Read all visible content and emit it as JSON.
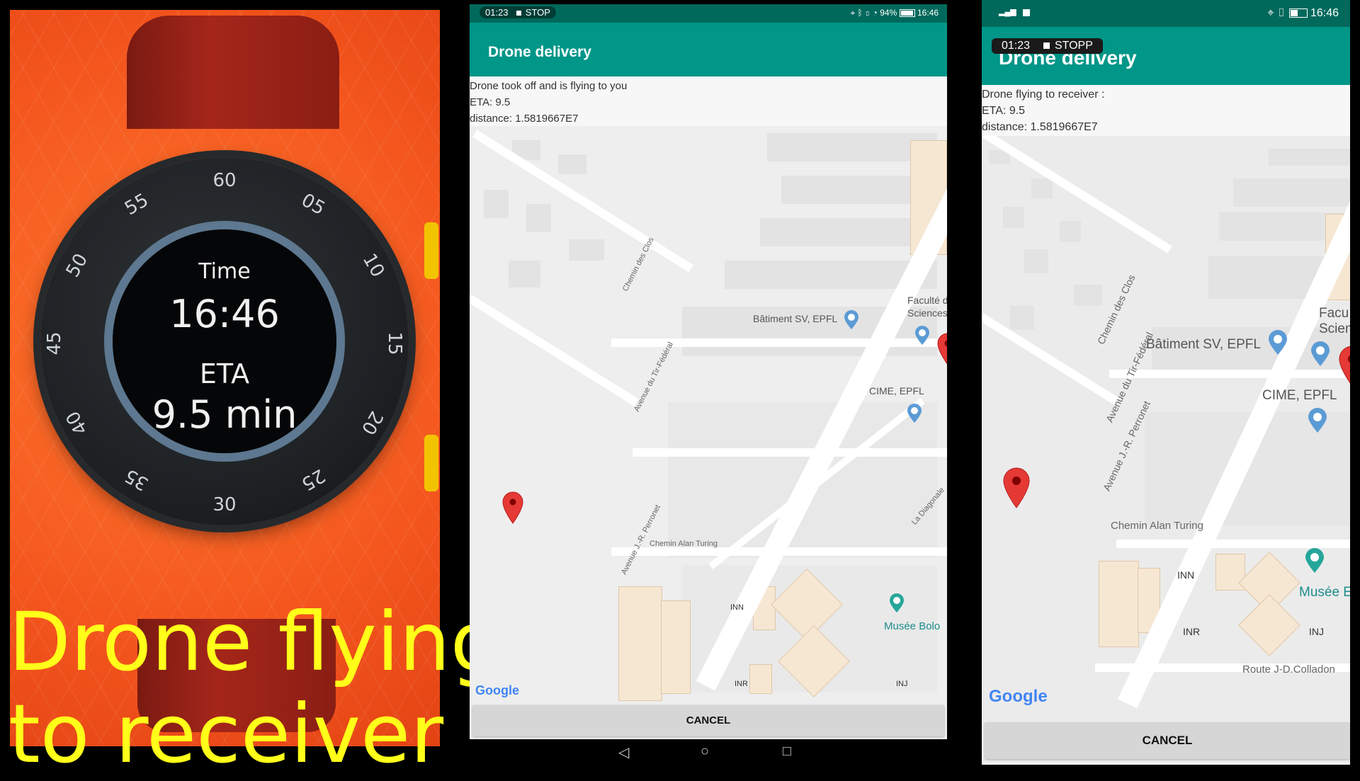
{
  "overlay": {
    "caption_line1": "Drone flying",
    "caption_line2": "to receiver"
  },
  "watch": {
    "time_label": "Time",
    "time_value": "16:46",
    "eta_label": "ETA",
    "eta_value": "9.5 min",
    "bezel_numbers": [
      "60",
      "05",
      "10",
      "15",
      "20",
      "25",
      "30",
      "35",
      "40",
      "45",
      "50",
      "55"
    ]
  },
  "phone1": {
    "status": {
      "recording_time": "01:23",
      "recording_action": "STOP",
      "battery": "94%",
      "clock": "16:46"
    },
    "app_title": "Drone delivery",
    "info": {
      "line1": "Drone took off and is flying to you",
      "line2": "ETA: 9.5",
      "line3": "distance: 1.5819667E7"
    },
    "map": {
      "roads": [
        "Chemin des Clos",
        "Avenue du Tir-Fédéral",
        "Avenue J.-R. Perronet",
        "Chemin Alan Turing",
        "La Diagonale"
      ],
      "places": [
        "Bâtiment SV, EPFL",
        "Faculté d",
        "Sciences",
        "CIME, EPFL",
        "Musée Bolo",
        "INN",
        "INR",
        "INJ"
      ],
      "attribution": "Google"
    },
    "cancel_label": "CANCEL"
  },
  "phone2": {
    "status": {
      "clock": "16:46"
    },
    "recording": {
      "time": "01:23",
      "action": "STOPP"
    },
    "app_title": "Drone delivery",
    "info": {
      "line1": "Drone flying to receiver :",
      "line2": "ETA: 9.5",
      "line3": "distance: 1.5819667E7"
    },
    "map": {
      "roads": [
        "Chemin des Clos",
        "Avenue du Tir-Fédéral",
        "Avenue J.-R. Perronet",
        "Chemin Alan Turing",
        "Route J-D.Colladon"
      ],
      "places": [
        "Bâtiment SV, EPFL",
        "Facu",
        "Scien",
        "CIME, EPFL",
        "Musée E",
        "INN",
        "INR",
        "INJ"
      ],
      "attribution": "Google"
    },
    "cancel_label": "CANCEL"
  },
  "colors": {
    "status_bar": "#00695c",
    "app_bar": "#009688",
    "map_pin": "#e53935",
    "caption": "#ffff1a",
    "background": "#f4561e"
  }
}
